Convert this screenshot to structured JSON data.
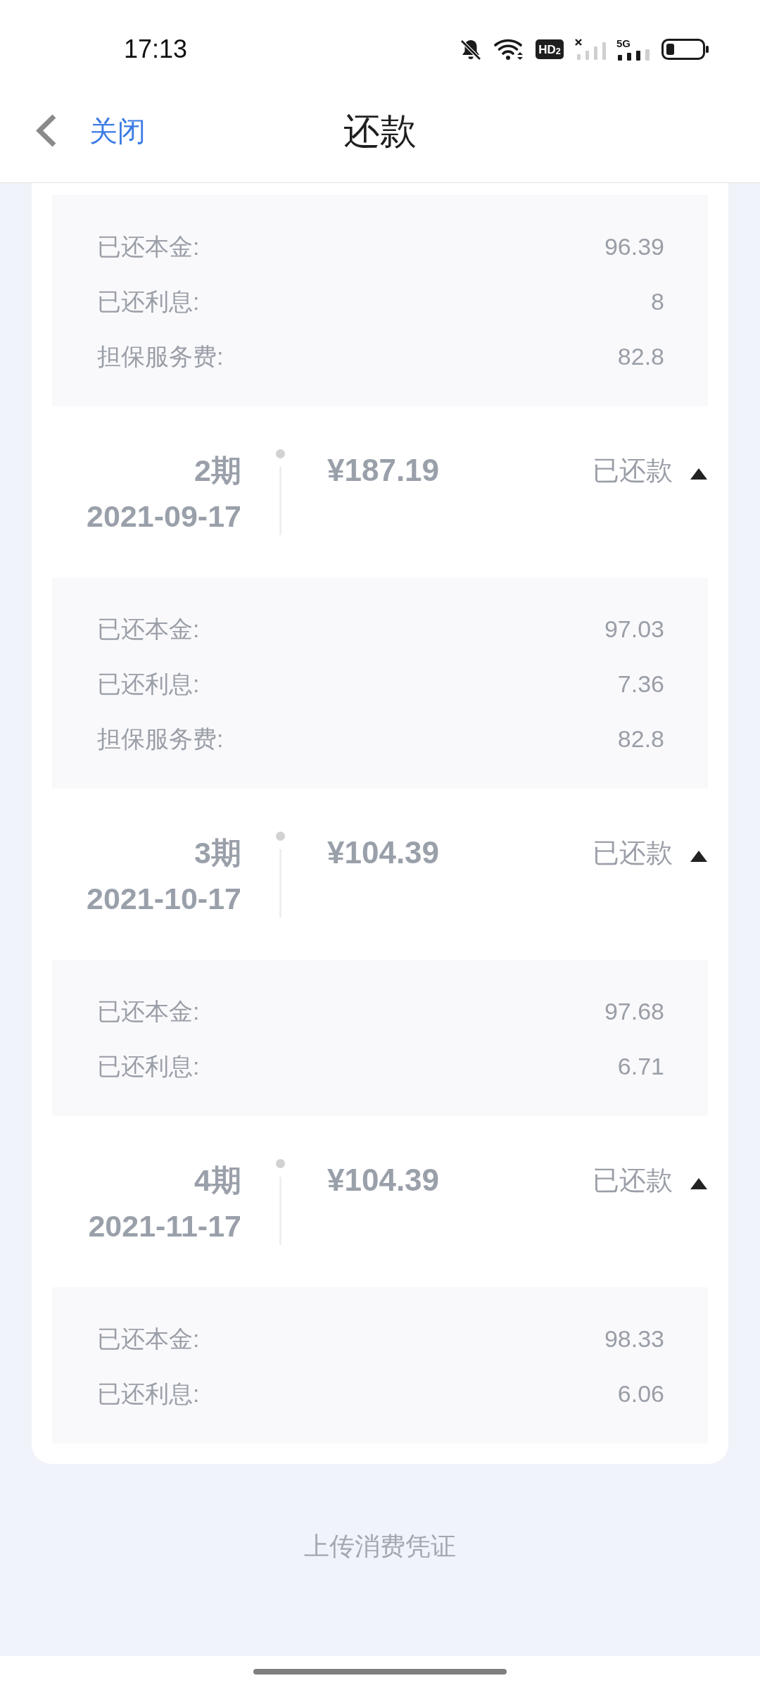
{
  "status_bar": {
    "time": "17:13",
    "hd_badge": "HD$_{2}$",
    "network": "5G"
  },
  "title_bar": {
    "back_label": "关闭",
    "title": "还款"
  },
  "installments": [
    {
      "details": [
        {
          "label": "已还本金:",
          "value": "96.39"
        },
        {
          "label": "已还利息:",
          "value": "8"
        },
        {
          "label": "担保服务费:",
          "value": "82.8"
        }
      ]
    },
    {
      "period": "2期",
      "date": "2021-09-17",
      "amount": "¥187.19",
      "status": "已还款",
      "expanded": true,
      "details": [
        {
          "label": "已还本金:",
          "value": "97.03"
        },
        {
          "label": "已还利息:",
          "value": "7.36"
        },
        {
          "label": "担保服务费:",
          "value": "82.8"
        }
      ]
    },
    {
      "period": "3期",
      "date": "2021-10-17",
      "amount": "¥104.39",
      "status": "已还款",
      "expanded": true,
      "details": [
        {
          "label": "已还本金:",
          "value": "97.68"
        },
        {
          "label": "已还利息:",
          "value": "6.71"
        }
      ]
    },
    {
      "period": "4期",
      "date": "2021-11-17",
      "amount": "¥104.39",
      "status": "已还款",
      "expanded": true,
      "details": [
        {
          "label": "已还本金:",
          "value": "98.33"
        },
        {
          "label": "已还利息:",
          "value": "6.06"
        }
      ]
    }
  ],
  "footer_link": "上传消费凭证"
}
